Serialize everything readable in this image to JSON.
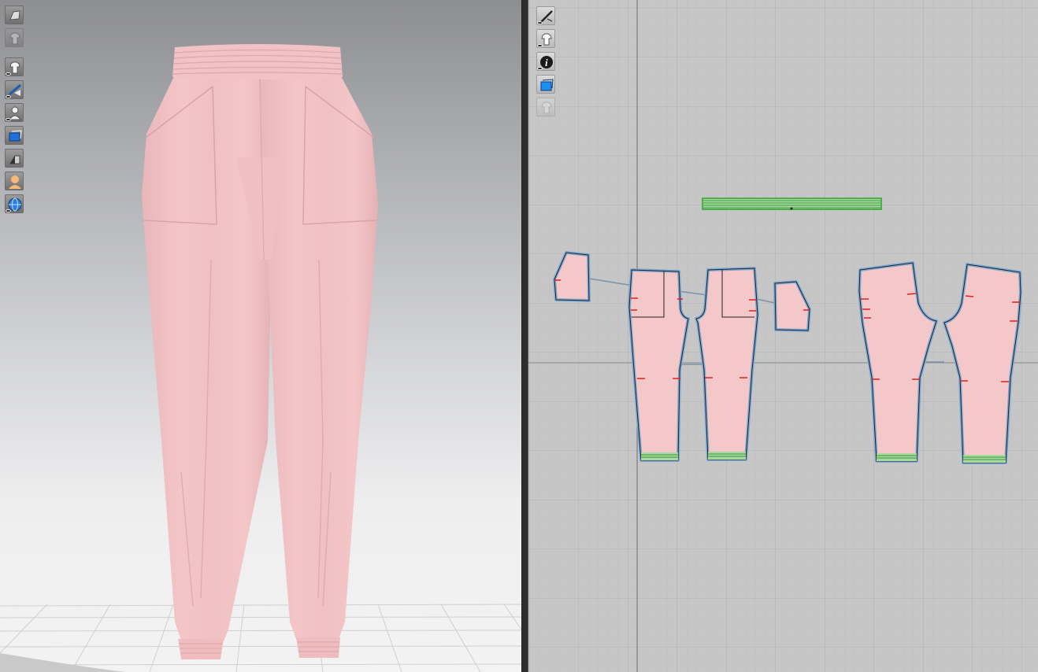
{
  "app": {
    "layout": "split-view",
    "garment_color": "#f3c4c6",
    "piece_outline_color": "#7ea9d4",
    "notch_color": "#e02020",
    "elastic_color": "#5dbb5d"
  },
  "view3d": {
    "toolbar": [
      {
        "name": "display-avatar-icon",
        "state": "on"
      },
      {
        "name": "display-garment-icon",
        "state": "on"
      },
      {
        "name": "show-garment-icon",
        "state": "on"
      },
      {
        "name": "show-pins-icon",
        "state": "on"
      },
      {
        "name": "show-avatar-icon",
        "state": "on"
      },
      {
        "name": "texture-display-icon",
        "state": "active"
      },
      {
        "name": "shading-icon",
        "state": "on"
      },
      {
        "name": "avatar-skin-icon",
        "state": "on"
      },
      {
        "name": "environment-globe-icon",
        "state": "on"
      }
    ],
    "floor_grid": "visible"
  },
  "view2d": {
    "toolbar": [
      {
        "name": "show-seamlines-icon",
        "state": "on"
      },
      {
        "name": "show-garment-2d-icon",
        "state": "on"
      },
      {
        "name": "pattern-info-icon",
        "state": "on"
      },
      {
        "name": "texture-2d-icon",
        "state": "active"
      },
      {
        "name": "lock-garment-icon",
        "state": "disabled"
      }
    ],
    "pattern_pieces": [
      "waistband",
      "front-pocket-left",
      "front-panel-left",
      "front-panel-right",
      "front-pocket-right",
      "back-panel-left",
      "back-panel-right"
    ],
    "grid": "visible"
  }
}
